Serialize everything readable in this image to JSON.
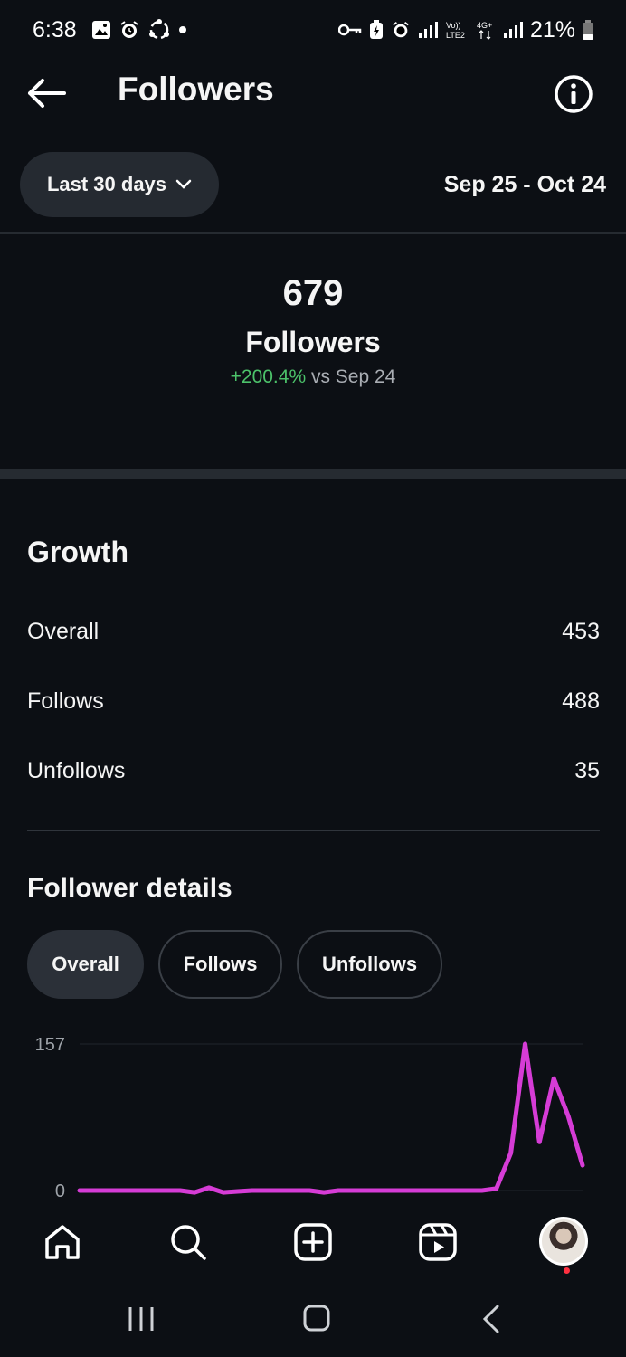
{
  "status_bar": {
    "time": "6:38",
    "battery": "21%"
  },
  "header": {
    "title": "Followers"
  },
  "filter": {
    "range_label": "Last 30 days",
    "date_range": "Sep 25 - Oct 24"
  },
  "summary": {
    "count": "679",
    "label": "Followers",
    "change": "+200.4%",
    "comparison": "vs Sep 24"
  },
  "growth": {
    "title": "Growth",
    "rows": [
      {
        "label": "Overall",
        "value": "453"
      },
      {
        "label": "Follows",
        "value": "488"
      },
      {
        "label": "Unfollows",
        "value": "35"
      }
    ]
  },
  "details": {
    "title": "Follower details",
    "tabs": [
      {
        "label": "Overall",
        "active": true
      },
      {
        "label": "Follows",
        "active": false
      },
      {
        "label": "Unfollows",
        "active": false
      }
    ]
  },
  "chart_data": {
    "type": "line",
    "y_ticks": [
      "157",
      "0"
    ],
    "ylim": [
      0,
      157
    ],
    "series": [
      {
        "color": "#d63cd6",
        "values": [
          0,
          0,
          0,
          0,
          0,
          0,
          0,
          0,
          -2,
          3,
          -2,
          -1,
          0,
          0,
          0,
          0,
          0,
          -2,
          0,
          0,
          0,
          0,
          0,
          0,
          0,
          0,
          0,
          0,
          0,
          2,
          40,
          157,
          52,
          120,
          80,
          27
        ]
      }
    ],
    "grid": true
  },
  "colors": {
    "background": "#0c0f14",
    "positive": "#4cc26a",
    "chart_line": "#d63cd6"
  },
  "icons": {
    "back": "arrow-left-icon",
    "info": "info-icon",
    "home": "home-icon",
    "search": "search-icon",
    "create": "plus-square-icon",
    "reels": "reels-icon"
  }
}
